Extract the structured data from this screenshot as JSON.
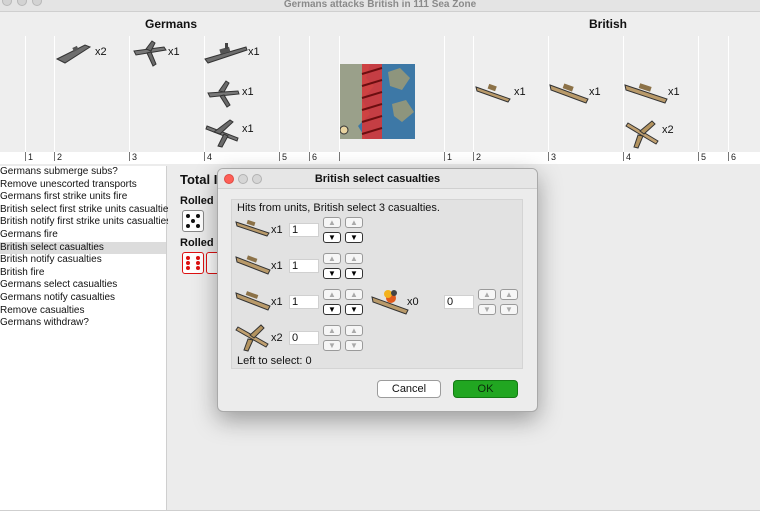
{
  "window": {
    "title": "Germans attacks British in 111 Sea Zone"
  },
  "board": {
    "attacker_label": "Germans",
    "defender_label": "British",
    "attacker_units": [
      {
        "type": "submarine-icon",
        "count": "x2"
      },
      {
        "type": "fighter-icon",
        "count": "x1"
      },
      {
        "type": "battleship-icon",
        "count": "x1"
      },
      {
        "type": "fighter-icon",
        "count": "x1"
      },
      {
        "type": "bomber-icon",
        "count": "x1"
      }
    ],
    "defender_units": [
      {
        "type": "destroyer-icon",
        "count": "x1"
      },
      {
        "type": "cruiser-icon",
        "count": "x1"
      },
      {
        "type": "battleship-icon",
        "count": "x1"
      },
      {
        "type": "fighter-icon",
        "count": "x2"
      }
    ],
    "attacker_ticks": [
      "1",
      "2",
      "3",
      "4",
      "5",
      "6"
    ],
    "defender_ticks": [
      "1",
      "2",
      "3",
      "4",
      "5",
      "6"
    ],
    "colors": {
      "german_unit": "#6e6e6e",
      "british_unit": "#b99a6a"
    }
  },
  "steps": [
    "Germans submerge subs?",
    "Remove unescorted transports",
    "Germans first strike units fire",
    "British select first strike units casualties",
    "British notify first strike units casualties",
    "Germans fire",
    "British select casualties",
    "British notify casualties",
    "British fire",
    "Germans select casualties",
    "Germans notify casualties",
    "Remove casualties",
    "Germans withdraw?"
  ],
  "selected_step": 6,
  "pane": {
    "total_label": "Total I",
    "rolled1": "Rolled 1",
    "rolled2": "Rolled 3"
  },
  "dialog": {
    "title": "British select casualties",
    "message": "Hits from units,  British select 3 casualties.",
    "rows": [
      {
        "unit": "destroyer-icon",
        "count": "x1",
        "value": "1"
      },
      {
        "unit": "cruiser-icon",
        "count": "x1",
        "value": "1"
      },
      {
        "unit": "battleship-icon",
        "count": "x1",
        "value": "1"
      },
      {
        "unit": "fighter-icon",
        "count": "x2",
        "value": "0"
      }
    ],
    "damaged": {
      "unit": "damaged-battleship-icon",
      "count": "x0",
      "value": "0"
    },
    "left_to_select": "Left to select: 0",
    "cancel_label": "Cancel",
    "ok_label": "OK",
    "ok_color": "#21a621"
  }
}
